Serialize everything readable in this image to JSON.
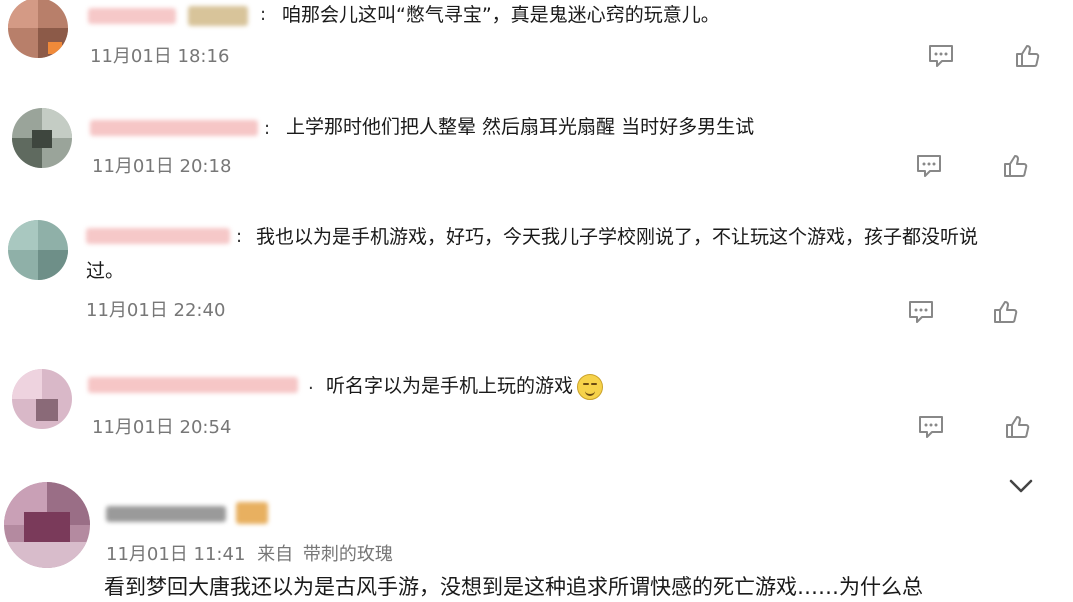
{
  "comments": [
    {
      "text": "咱那会儿这叫“憋气寻宝”，真是鬼迷心窍的玩意儿。",
      "time": "11月01日 18:16"
    },
    {
      "text": "上学那时他们把人整晕 然后扇耳光扇醒 当时好多男生试",
      "time": "11月01日 20:18"
    },
    {
      "text_line1": "我也以为是手机游戏，好巧，今天我儿子学校刚说了，不让玩这个游戏，孩子都没听说",
      "text_line2": "过。",
      "time": "11月01日 22:40"
    },
    {
      "text": "听名字以为是手机上玩的游戏",
      "time": "11月01日 20:54"
    },
    {
      "time": "11月01日 11:41",
      "source_prefix": "来自",
      "source": "带刺的玫瑰",
      "text": "看到梦回大唐我还以为是古风手游，没想到是这种追求所谓快感的死亡游戏……为什么总"
    }
  ],
  "icons": {
    "comment": "comment-icon",
    "like": "thumbs-up-icon",
    "expand": "chevron-down-icon"
  },
  "colors": {
    "text": "#1a1a1a",
    "time": "#777777",
    "icon": "#888888",
    "name_blur": "#f3b8b8"
  }
}
